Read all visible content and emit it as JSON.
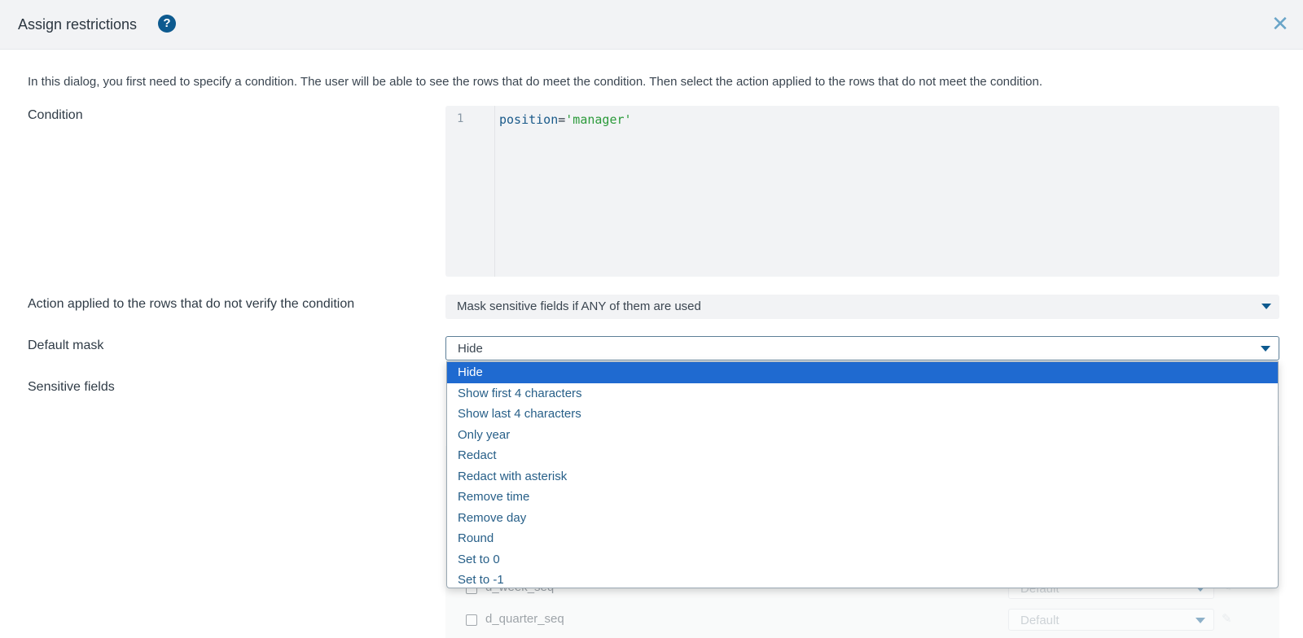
{
  "header": {
    "title": "Assign restrictions",
    "help_icon": "?",
    "close_icon": "✕"
  },
  "intro": "In this dialog, you first need to specify a condition. The user will be able to see the rows that do meet the condition. Then select the action applied to the rows that do not meet the condition.",
  "condition": {
    "label": "Condition",
    "line_number": "1",
    "code_ident": "position",
    "code_op": "=",
    "code_string": "'manager'"
  },
  "action": {
    "label": "Action applied to the rows that do not verify the condition",
    "value": "Mask sensitive fields if ANY of them are used"
  },
  "default_mask": {
    "label": "Default mask",
    "value": "Hide",
    "options": [
      "Hide",
      "Show first 4 characters",
      "Show last 4 characters",
      "Only year",
      "Redact",
      "Redact with asterisk",
      "Remove time",
      "Remove day",
      "Round",
      "Set to 0",
      "Set to -1"
    ]
  },
  "sensitive_fields": {
    "label": "Sensitive fields",
    "rows": [
      {
        "name": "d_week_seq",
        "mask": "Default"
      },
      {
        "name": "d_quarter_seq",
        "mask": "Default"
      }
    ]
  },
  "icons": {
    "help": "help-icon",
    "close": "close-icon",
    "caret": "caret-down-icon",
    "edit": "pencil-icon"
  },
  "colors": {
    "accent": "#0d5a8f",
    "selected_option": "#1f6ad0",
    "option_text": "#275f88",
    "code_string": "#2b9a3a",
    "code_ident": "#1a5a8a"
  }
}
